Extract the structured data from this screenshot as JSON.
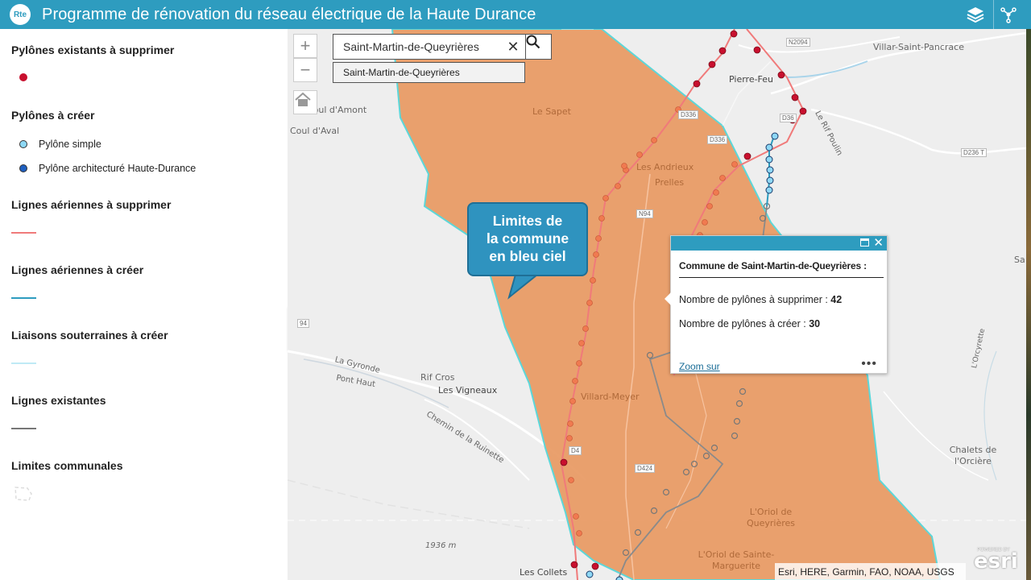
{
  "header": {
    "logo_text": "Rte",
    "title": "Programme de rénovation du réseau électrique de la Haute Durance",
    "layers_icon": "layers-icon",
    "share_icon": "share-icon"
  },
  "legend": {
    "groups": [
      {
        "title": "Pylônes existants à supprimer",
        "items": [
          {
            "label": "",
            "color": "#c8102e"
          }
        ]
      },
      {
        "title": "Pylônes à créer",
        "items": [
          {
            "label": "Pylône simple",
            "color": "#8ed8f5"
          },
          {
            "label": "Pylône architecturé Haute-Durance",
            "color": "#1f5fbf"
          }
        ]
      },
      {
        "title": "Lignes aériennes à supprimer",
        "line_color": "#f07a7a"
      },
      {
        "title": "Lignes aériennes à créer",
        "line_color": "#2e9cbf"
      },
      {
        "title": "Liaisons souterraines à créer",
        "line_color": "#bfeaf5"
      },
      {
        "title": "Lignes existantes",
        "line_color": "#777777"
      },
      {
        "title": "Limites communales"
      }
    ]
  },
  "search": {
    "value": "Saint-Martin-de-Queyrières",
    "suggestion": "Saint-Martin-de-Queyrières"
  },
  "callout": {
    "text_lines": [
      "Limites de",
      "la commune",
      "en bleu ciel"
    ]
  },
  "popup": {
    "title": "Commune de Saint-Martin-de-Queyrières :",
    "row1_label": "Nombre de pylônes à supprimer :",
    "row1_value": "42",
    "row2_label": "Nombre de pylônes à créer :",
    "row2_value": "30",
    "zoom_link": "Zoom sur",
    "more": "•••"
  },
  "map": {
    "places": [
      {
        "name": "Villar-Saint-Pancrace"
      },
      {
        "name": "Pierre-Feu"
      },
      {
        "name": "Le Rif Poulin"
      },
      {
        "name": "Coul d'Amont"
      },
      {
        "name": "Coul d'Aval"
      },
      {
        "name": "Le Sapet"
      },
      {
        "name": "Les Andrieux"
      },
      {
        "name": "Prelles"
      },
      {
        "name": "La Gyronde"
      },
      {
        "name": "Pont Haut"
      },
      {
        "name": "Rif Cros"
      },
      {
        "name": "Les Vigneaux"
      },
      {
        "name": "Chemin de la Ruinette"
      },
      {
        "name": "Villard-Meyer"
      },
      {
        "name": "L'Oriol de Queyrières"
      },
      {
        "name": "L'Oriol de Sainte-Marguerite"
      },
      {
        "name": "Chalets de l'Orcière"
      },
      {
        "name": "L'Orcyrette"
      },
      {
        "name": "Les Collets"
      },
      {
        "name": "1936 m"
      },
      {
        "name": "Sa"
      }
    ],
    "roads": [
      "N2094",
      "D36",
      "D336",
      "D336",
      "D236 T",
      "N94",
      "D4",
      "D424",
      "94"
    ],
    "attribution": "Esri, HERE, Garmin, FAO, NOAA, USGS",
    "esri_logo": "esri",
    "esri_powered": "POWERED BY"
  }
}
